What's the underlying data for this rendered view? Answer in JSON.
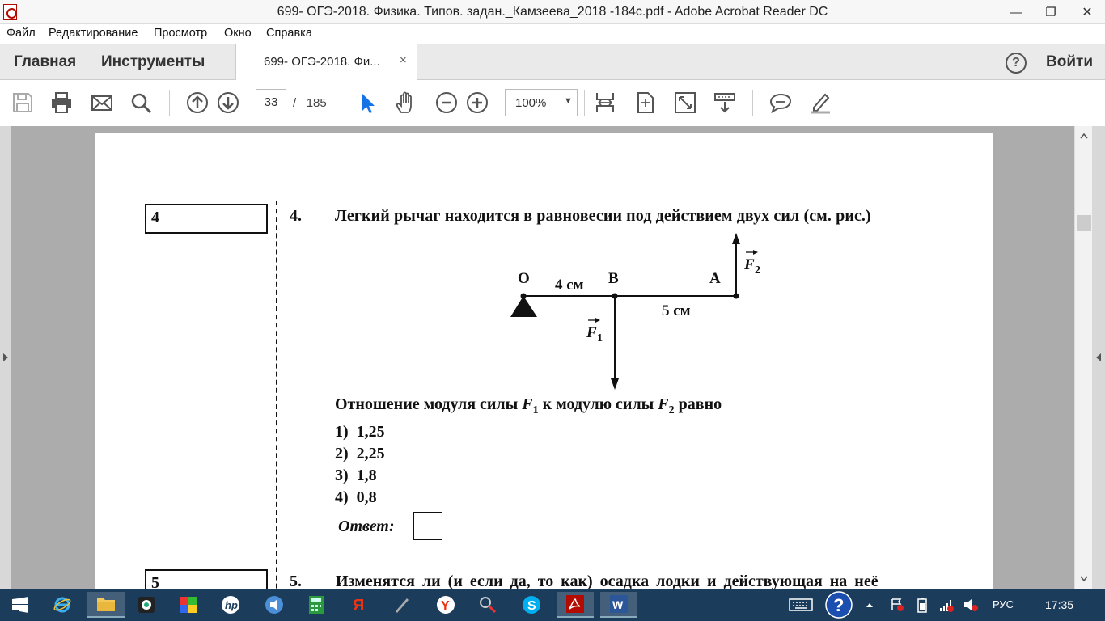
{
  "window": {
    "title": "699- ОГЭ-2018. Физика. Типов. задан._Камзеева_2018 -184c.pdf - Adobe Acrobat Reader DC",
    "minimize": "—",
    "maximize": "❐",
    "close": "✕"
  },
  "menu": [
    "Файл",
    "Редактирование",
    "Просмотр",
    "Окно",
    "Справка"
  ],
  "tabs": {
    "home": "Главная",
    "tools": "Инструменты",
    "document": "699- ОГЭ-2018. Фи...",
    "close": "×",
    "signin": "Войти"
  },
  "toolbar": {
    "page_current": "33",
    "page_separator": "/",
    "page_total": "185",
    "zoom": "100%"
  },
  "document": {
    "q4": {
      "box_number": "4",
      "number": "4.",
      "text": "Легкий рычаг находится в равновесии под действием двух сил (см. рис.)",
      "figure": {
        "label_o": "О",
        "label_b": "В",
        "label_a": "А",
        "dist_ob": "4 см",
        "dist_ba": "5 см",
        "f1": "F",
        "f1_sub": "1",
        "f2": "F",
        "f2_sub": "2"
      },
      "ratio": {
        "part1": "Отношение модуля силы ",
        "f1": "F",
        "f1_sub": "1",
        "part2": " к модулю силы ",
        "f2": "F",
        "f2_sub": "2",
        "part3": " равно"
      },
      "options": [
        "1)  1,25",
        "2)  2,25",
        "3)  1,8",
        "4)  0,8"
      ],
      "answer_label": "Ответ:"
    },
    "q5": {
      "box_number": "5",
      "number": "5.",
      "text": "Изменятся ли (и если да, то как) осадка лодки и действующая на неё"
    }
  },
  "taskbar": {
    "language": "РУС",
    "time": "17:35"
  }
}
